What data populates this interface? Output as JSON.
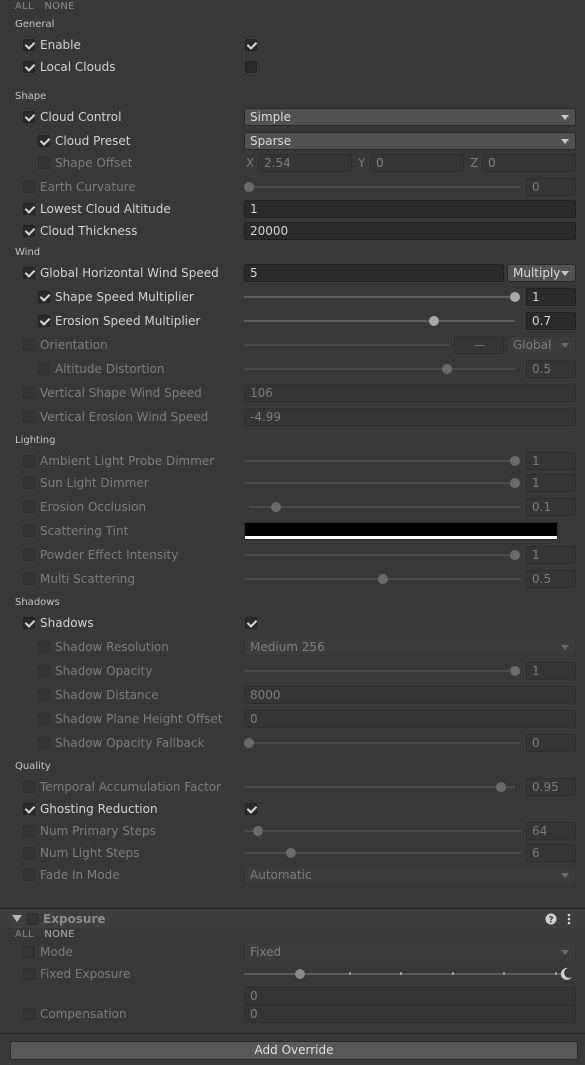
{
  "top_links": {
    "all": "ALL",
    "none": "NONE"
  },
  "sections": {
    "general": "General",
    "shape": "Shape",
    "wind": "Wind",
    "lighting": "Lighting",
    "shadows": "Shadows",
    "quality": "Quality"
  },
  "general": {
    "enable": {
      "label": "Enable"
    },
    "local_clouds": {
      "label": "Local Clouds"
    }
  },
  "shape": {
    "cloud_control": {
      "label": "Cloud Control",
      "value": "Simple"
    },
    "cloud_preset": {
      "label": "Cloud Preset",
      "value": "Sparse"
    },
    "shape_offset": {
      "label": "Shape Offset",
      "x_label": "X",
      "x": "2.54",
      "y_label": "Y",
      "y": "0",
      "z_label": "Z",
      "z": "0"
    },
    "earth_curvature": {
      "label": "Earth Curvature",
      "value": "0",
      "fraction": 0
    },
    "lowest_cloud_altitude": {
      "label": "Lowest Cloud Altitude",
      "value": "1"
    },
    "cloud_thickness": {
      "label": "Cloud Thickness",
      "value": "20000"
    }
  },
  "wind": {
    "global_horizontal_wind_speed": {
      "label": "Global Horizontal Wind Speed",
      "value": "5",
      "mode": "Multiply"
    },
    "shape_speed_multiplier": {
      "label": "Shape Speed Multiplier",
      "value": "1",
      "fraction": 1
    },
    "erosion_speed_multiplier": {
      "label": "Erosion Speed Multiplier",
      "value": "0.7",
      "fraction": 0.7
    },
    "orientation": {
      "label": "Orientation",
      "value": "—",
      "mode": "Global"
    },
    "altitude_distortion": {
      "label": "Altitude Distortion",
      "value": "0.5",
      "fraction": 0.75
    },
    "vertical_shape_wind_speed": {
      "label": "Vertical Shape Wind Speed",
      "value": "106"
    },
    "vertical_erosion_wind_speed": {
      "label": "Vertical Erosion Wind Speed",
      "value": "-4.99"
    }
  },
  "lighting": {
    "ambient_light_probe_dimmer": {
      "label": "Ambient Light Probe Dimmer",
      "value": "1",
      "fraction": 1
    },
    "sun_light_dimmer": {
      "label": "Sun Light Dimmer",
      "value": "1",
      "fraction": 1
    },
    "erosion_occlusion": {
      "label": "Erosion Occlusion",
      "value": "0.1",
      "fraction": 0.1
    },
    "scattering_tint": {
      "label": "Scattering Tint",
      "color": "#000000"
    },
    "powder_effect_intensity": {
      "label": "Powder Effect Intensity",
      "value": "1",
      "fraction": 1
    },
    "multi_scattering": {
      "label": "Multi Scattering",
      "value": "0.5",
      "fraction": 0.5
    }
  },
  "shadows": {
    "shadows": {
      "label": "Shadows"
    },
    "shadow_resolution": {
      "label": "Shadow Resolution",
      "value": "Medium 256"
    },
    "shadow_opacity": {
      "label": "Shadow Opacity",
      "value": "1",
      "fraction": 1
    },
    "shadow_distance": {
      "label": "Shadow Distance",
      "value": "8000"
    },
    "shadow_plane_height_offset": {
      "label": "Shadow Plane Height Offset",
      "value": "0"
    },
    "shadow_opacity_fallback": {
      "label": "Shadow Opacity Fallback",
      "value": "0",
      "fraction": 0
    }
  },
  "quality": {
    "temporal_accumulation_factor": {
      "label": "Temporal Accumulation Factor",
      "value": "0.95",
      "fraction": 0.95
    },
    "ghosting_reduction": {
      "label": "Ghosting Reduction"
    },
    "num_primary_steps": {
      "label": "Num Primary Steps",
      "value": "64",
      "fraction": 0.05
    },
    "num_light_steps": {
      "label": "Num Light Steps",
      "value": "6",
      "fraction": 0.17
    },
    "fade_in_mode": {
      "label": "Fade In Mode",
      "value": "Automatic"
    }
  },
  "exposure": {
    "title": "Exposure",
    "all": "ALL",
    "none": "NONE",
    "mode": {
      "label": "Mode",
      "value": "Fixed"
    },
    "fixed_exposure": {
      "label": "Fixed Exposure",
      "value": "0"
    },
    "compensation": {
      "label": "Compensation",
      "value": "0"
    }
  },
  "add_override": "Add Override"
}
